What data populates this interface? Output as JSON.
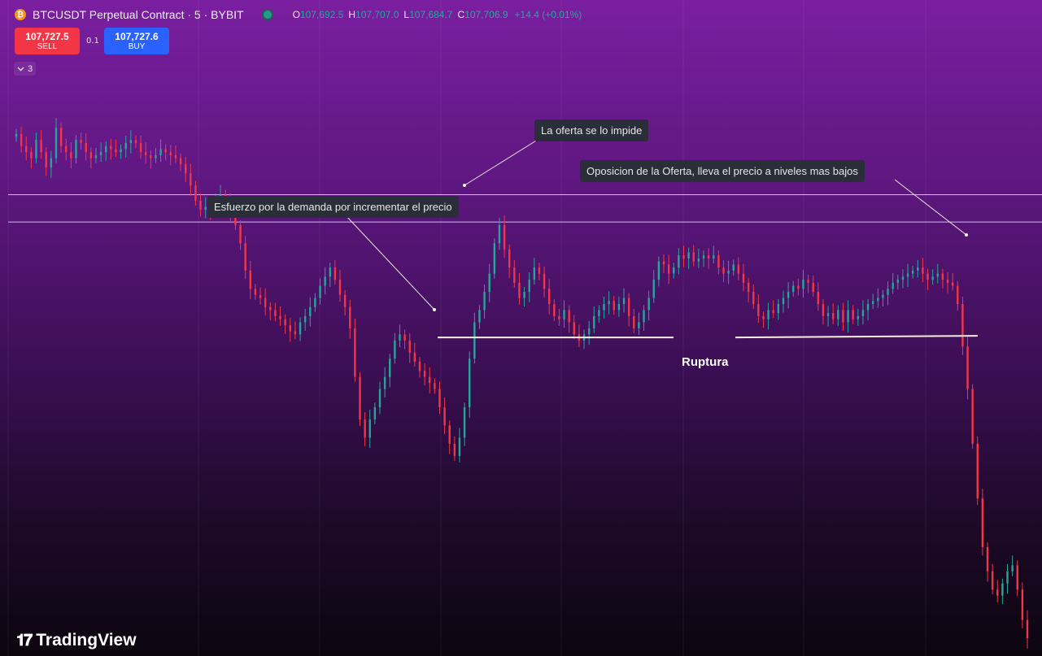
{
  "header": {
    "title": "BTCUSDT Perpetual Contract · 5 · BYBIT",
    "coin_icon": "bitcoin-icon",
    "coin_symbol": "₿",
    "ohlc": {
      "o_key": "O",
      "o_val": "107,692.5",
      "h_key": "H",
      "h_val": "107,707.0",
      "l_key": "L",
      "l_val": "107,684.7",
      "c_key": "C",
      "c_val": "107,706.9",
      "change": "+14.4 (+0.01%)"
    }
  },
  "trade": {
    "sell_price": "107,727.5",
    "sell_label": "SELL",
    "spread": "0.1",
    "buy_price": "107,727.6",
    "buy_label": "BUY"
  },
  "indicator_toggle": {
    "icon": "chevron-down-icon",
    "count": "3"
  },
  "annotations": {
    "demand_effort": "Esfuerzo por la demanda por incrementar el precio",
    "supply_stops": "La oferta se lo impide",
    "supply_opposition": "Oposicion de la Oferta, lleva el precio a niveles mas bajos",
    "rupture": "Ruptura"
  },
  "branding": {
    "logo_text": "TradingView",
    "logo_icon": "tradingview-logo-icon"
  },
  "colors": {
    "up": "#26a69a",
    "down": "#f23645",
    "sell_button": "#f23645",
    "buy_button": "#2962ff",
    "level_line": "#c9c0e6",
    "rupture_line": "#f5efdc"
  },
  "chart_data": {
    "type": "candlestick",
    "title": "BTCUSDT Perpetual Contract · 5 · BYBIT",
    "xlabel": "",
    "ylabel": "",
    "y_unit": "USDT",
    "ylim": [
      106950,
      107900
    ],
    "grid": "vertical lines only",
    "legend": "none",
    "horizontal_levels": [
      107700,
      107655
    ],
    "rupture_level": 107465,
    "candles_close": [
      107800,
      107780,
      107770,
      107760,
      107790,
      107770,
      107745,
      107760,
      107810,
      107780,
      107770,
      107760,
      107790,
      107785,
      107770,
      107760,
      107765,
      107770,
      107780,
      107775,
      107770,
      107775,
      107785,
      107790,
      107785,
      107770,
      107765,
      107760,
      107765,
      107775,
      107770,
      107765,
      107760,
      107750,
      107735,
      107715,
      107690,
      107675,
      107680,
      107675,
      107690,
      107700,
      107690,
      107670,
      107650,
      107620,
      107575,
      107545,
      107535,
      107530,
      107515,
      107510,
      107500,
      107495,
      107485,
      107475,
      107470,
      107490,
      107500,
      107515,
      107530,
      107550,
      107565,
      107580,
      107560,
      107535,
      107515,
      107480,
      107400,
      107330,
      107300,
      107330,
      107350,
      107380,
      107400,
      107430,
      107460,
      107470,
      107460,
      107440,
      107425,
      107410,
      107400,
      107390,
      107380,
      107350,
      107320,
      107290,
      107270,
      107300,
      107350,
      107430,
      107490,
      107510,
      107540,
      107570,
      107620,
      107650,
      107610,
      107580,
      107555,
      107530,
      107540,
      107560,
      107580,
      107570,
      107545,
      107520,
      107500,
      107495,
      107510,
      107490,
      107470,
      107460,
      107470,
      107480,
      107500,
      107510,
      107520,
      107525,
      107510,
      107520,
      107530,
      107500,
      107480,
      107490,
      107510,
      107530,
      107560,
      107590,
      107585,
      107570,
      107580,
      107600,
      107595,
      107605,
      107590,
      107595,
      107600,
      107595,
      107600,
      107580,
      107570,
      107575,
      107585,
      107570,
      107555,
      107540,
      107520,
      107500,
      107495,
      107510,
      107505,
      107520,
      107530,
      107540,
      107550,
      107545,
      107560,
      107555,
      107540,
      107520,
      107500,
      107505,
      107495,
      107510,
      107490,
      107510,
      107495,
      107500,
      107510,
      107520,
      107525,
      107530,
      107535,
      107545,
      107555,
      107560,
      107565,
      107570,
      107575,
      107580,
      107570,
      107560,
      107565,
      107570,
      107560,
      107555,
      107550,
      107520,
      107450,
      107380,
      107290,
      107200,
      107120,
      107080,
      107050,
      107040,
      107060,
      107080,
      107090,
      107050,
      107000,
      106970
    ]
  }
}
